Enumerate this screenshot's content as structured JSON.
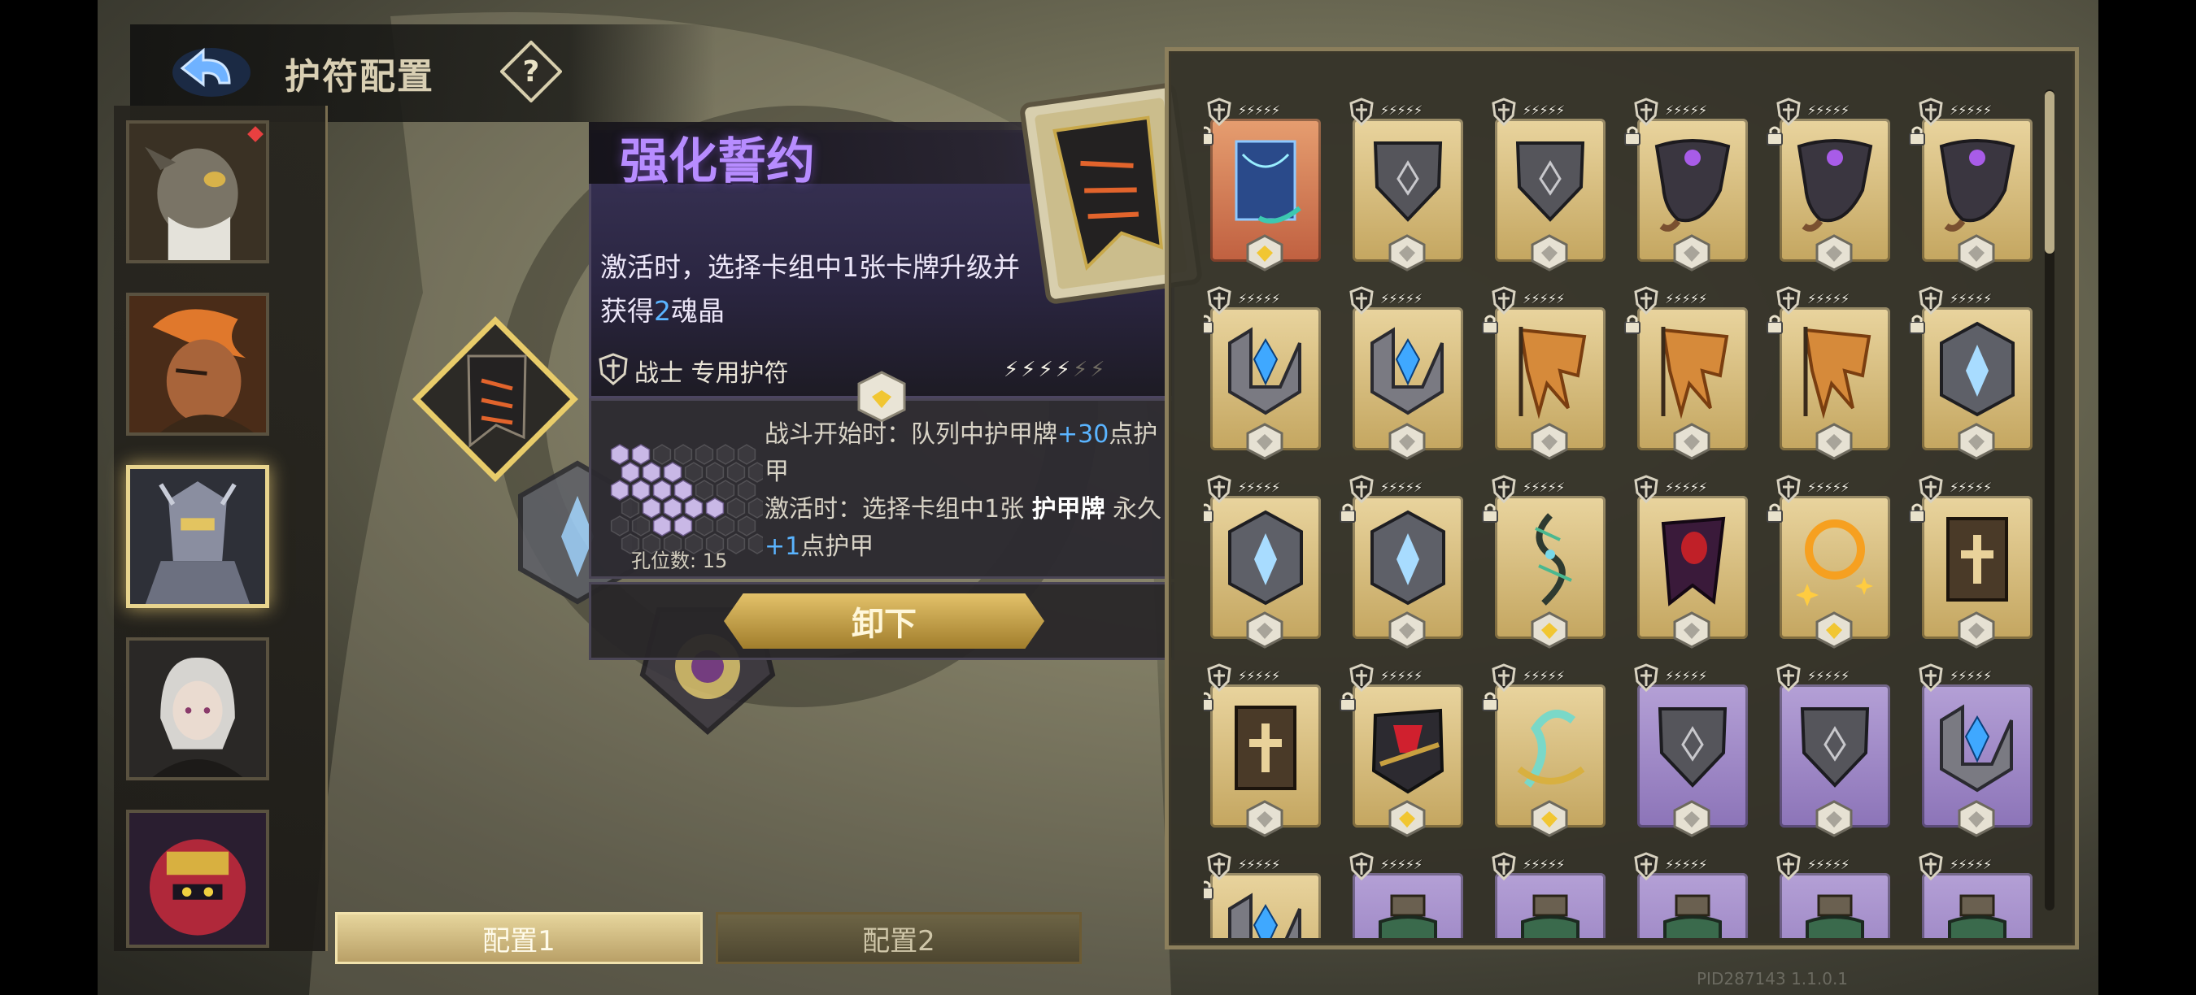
{
  "header": {
    "title": "护符配置"
  },
  "heroes": [
    {
      "name": "hero-beastman",
      "badge": true
    },
    {
      "name": "hero-flame-warrior",
      "badge": false
    },
    {
      "name": "hero-armored-knight",
      "badge": false,
      "selected": true
    },
    {
      "name": "hero-silver-hair-girl",
      "badge": false
    },
    {
      "name": "hero-masked-crown",
      "badge": false
    }
  ],
  "config_tabs": [
    {
      "label": "配置1"
    },
    {
      "label": "配置2"
    }
  ],
  "detail": {
    "title": "强化誓约",
    "desc_line1": "激活时，选择卡组中1张卡牌升级并",
    "desc_line2_pre": "获得",
    "desc_line2_num": "2",
    "desc_line2_post": "魂晶",
    "class_label": "战士 专用护符",
    "rune": {
      "slots_label": "孔位数: 15",
      "line1_pre": "战斗开始时：队列中护甲牌",
      "line1_num": "+30",
      "line1_post": "点护甲",
      "line2_pre": "激活时：选择卡组中1张 ",
      "line2_bold": "护甲牌",
      "line2_mid": " 永久",
      "line2_num": "+1",
      "line2_post": "点护甲"
    },
    "unequip_label": "卸下"
  },
  "grid_items": [
    {
      "art": "spellbook",
      "bg": "orange",
      "lock": true,
      "socket": "gold"
    },
    {
      "art": "shield-stone",
      "bg": "gold",
      "lock": false,
      "socket": "gray"
    },
    {
      "art": "shield-stone",
      "bg": "gold",
      "lock": false,
      "socket": "gray"
    },
    {
      "art": "horn-purple-eye",
      "bg": "gold",
      "lock": true,
      "socket": "gray"
    },
    {
      "art": "horn-purple-eye",
      "bg": "gold",
      "lock": true,
      "socket": "gray"
    },
    {
      "art": "horn-purple-eye",
      "bg": "gold",
      "lock": true,
      "socket": "gray"
    },
    {
      "art": "crystal-shield",
      "bg": "gold",
      "lock": true,
      "socket": "gray"
    },
    {
      "art": "crystal-shield",
      "bg": "gold",
      "lock": false,
      "socket": "gray"
    },
    {
      "art": "torn-flag",
      "bg": "gold",
      "lock": true,
      "socket": "gray"
    },
    {
      "art": "torn-flag",
      "bg": "gold",
      "lock": true,
      "socket": "gray"
    },
    {
      "art": "torn-flag",
      "bg": "gold",
      "lock": true,
      "socket": "gray"
    },
    {
      "art": "rune-stone",
      "bg": "gold",
      "lock": true,
      "socket": "gray"
    },
    {
      "art": "rune-stone",
      "bg": "gold",
      "lock": true,
      "socket": "gray"
    },
    {
      "art": "rune-stone",
      "bg": "gold",
      "lock": true,
      "socket": "gray"
    },
    {
      "art": "thorn-vine",
      "bg": "gold",
      "lock": true,
      "socket": "gold"
    },
    {
      "art": "dark-cloak",
      "bg": "gold",
      "lock": false,
      "socket": "gray"
    },
    {
      "art": "fire-ring",
      "bg": "gold",
      "lock": true,
      "socket": "gold"
    },
    {
      "art": "cross-tome",
      "bg": "gold",
      "lock": true,
      "socket": "gray"
    },
    {
      "art": "cross-tome",
      "bg": "gold",
      "lock": true,
      "socket": "gray"
    },
    {
      "art": "ruby-gauntlet",
      "bg": "gold",
      "lock": true,
      "socket": "gold"
    },
    {
      "art": "serpent-charm",
      "bg": "gold",
      "lock": true,
      "socket": "gold"
    },
    {
      "art": "shield-stone",
      "bg": "purple",
      "lock": false,
      "socket": "gray"
    },
    {
      "art": "shield-stone",
      "bg": "purple",
      "lock": false,
      "socket": "gray"
    },
    {
      "art": "crystal-shield",
      "bg": "purple",
      "lock": false,
      "socket": "gray"
    },
    {
      "art": "crystal-shield",
      "bg": "gold",
      "lock": true,
      "socket": "gray"
    },
    {
      "art": "potion",
      "bg": "purple",
      "lock": false,
      "socket": "gray"
    },
    {
      "art": "potion",
      "bg": "purple",
      "lock": false,
      "socket": "gray"
    },
    {
      "art": "potion",
      "bg": "purple",
      "lock": false,
      "socket": "gray"
    },
    {
      "art": "potion",
      "bg": "purple",
      "lock": false,
      "socket": "gray"
    },
    {
      "art": "potion",
      "bg": "purple",
      "lock": false,
      "socket": "gray"
    }
  ],
  "footer": {
    "pid": "PID287143 1.1.0.1"
  }
}
